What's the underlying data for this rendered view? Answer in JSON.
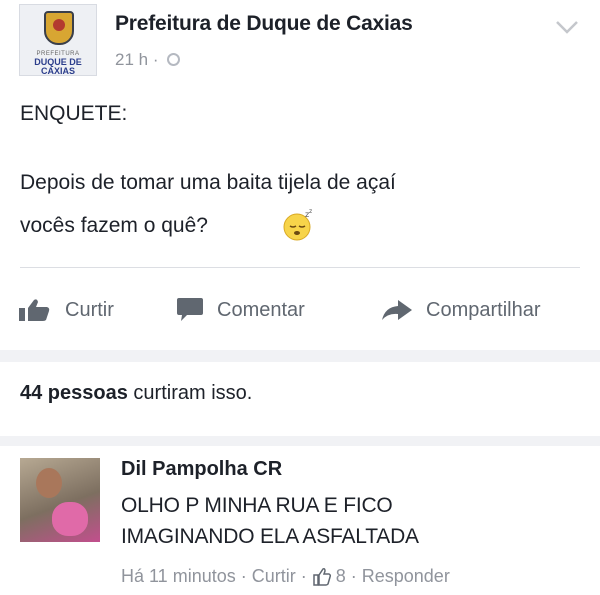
{
  "post": {
    "page_name": "Prefeitura de Duque de Caxias",
    "time": "21 h",
    "meta_sep": "·",
    "logo_small_text": "PREFEITURA",
    "logo_text_1": "DUQUE DE",
    "logo_text_2": "CAXIAS",
    "heading": "ENQUETE:",
    "line1": "Depois de tomar uma baita tijela de açaí",
    "line2": "vocês fazem o quê?",
    "emoji": "sleeping-face-icon"
  },
  "actions": {
    "like": "Curtir",
    "comment": "Comentar",
    "share": "Compartilhar"
  },
  "likes": {
    "count_text": "44 pessoas",
    "suffix": "curtiram isso."
  },
  "comment": {
    "author": "Dil Pampolha CR",
    "line1": "OLHO P MINHA RUA E FICO",
    "line2": "IMAGINANDO ELA ASFALTADA",
    "time": "Há 11 minutos",
    "like": "Curtir",
    "like_count": "8",
    "reply": "Responder",
    "sep": "·"
  },
  "colors": {
    "text": "#1d2129",
    "muted": "#90949c",
    "action_icon": "#606770"
  }
}
